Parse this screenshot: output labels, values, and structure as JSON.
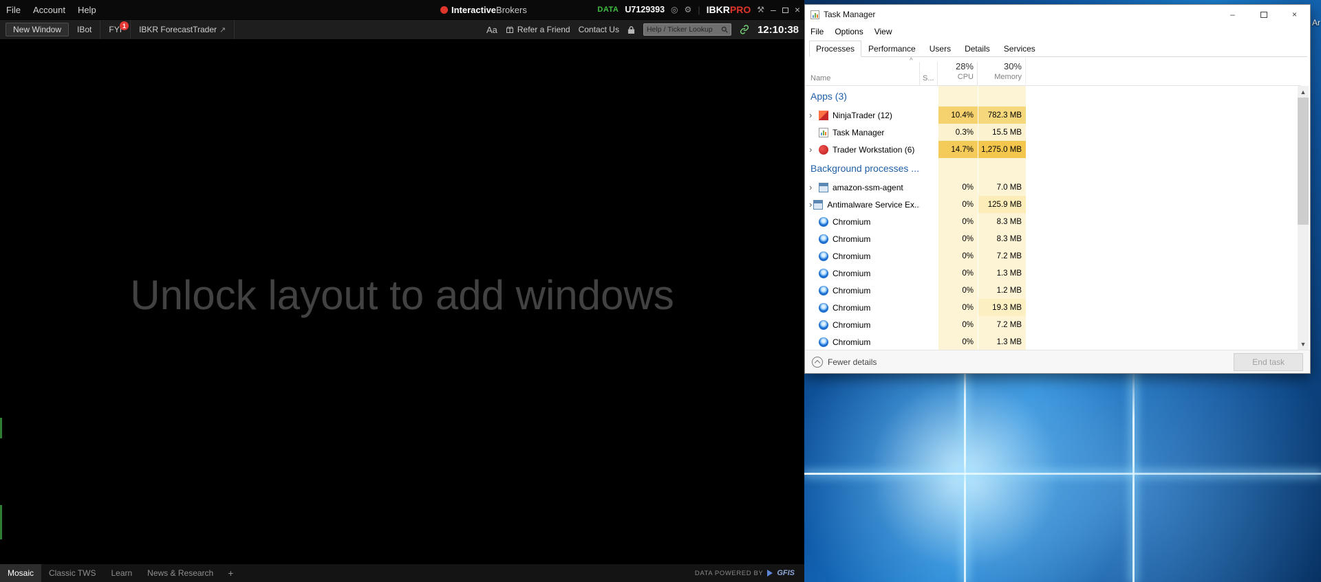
{
  "tws": {
    "menubar": {
      "items": [
        "File",
        "Account",
        "Help"
      ]
    },
    "logo": {
      "part1": "Interactive",
      "part2": "Brokers"
    },
    "status": {
      "data_label": "DATA",
      "account": "U7129393"
    },
    "brand": {
      "ibkr": "IBKR",
      "pro": "PRO"
    },
    "toolbar": {
      "new_window": "New Window",
      "ibot": "IBot",
      "fyi": "FYI",
      "fyi_badge": "1",
      "forecast": "IBKR ForecastTrader",
      "forecast_arrow": "↗",
      "font_toggle": "Aa",
      "refer": "Refer a Friend",
      "contact": "Contact Us",
      "search_placeholder": "Help / Ticker Lookup",
      "time": "12:10:38"
    },
    "main_message": "Unlock layout to add windows",
    "bottombar": {
      "tabs": [
        "Mosaic",
        "Classic TWS",
        "Learn",
        "News & Research"
      ],
      "add_tab": "+",
      "powered_by": "DATA POWERED BY",
      "provider": "GFIS"
    }
  },
  "task_manager": {
    "title": "Task Manager",
    "menu": [
      "File",
      "Options",
      "View"
    ],
    "tabs": [
      "Processes",
      "Performance",
      "Users",
      "Details",
      "Services"
    ],
    "active_tab": "Processes",
    "columns": {
      "name": "Name",
      "status": "S...",
      "cpu_total": "28%",
      "cpu_label": "CPU",
      "mem_total": "30%",
      "mem_label": "Memory"
    },
    "heading_cell_color": "#fdf4d6",
    "groups": [
      {
        "label": "Apps (3)",
        "rows": [
          {
            "name": "NinjaTrader (12)",
            "icon": "ninjatrader-icon",
            "expandable": true,
            "cpu": "10.4%",
            "memory": "782.3 MB",
            "cpu_color": "#f6d26e",
            "mem_color": "#f6d87c"
          },
          {
            "name": "Task Manager",
            "icon": "taskmanager-icon",
            "expandable": false,
            "cpu": "0.3%",
            "memory": "15.5 MB",
            "cpu_color": "#fdf2cf",
            "mem_color": "#fdf2cf"
          },
          {
            "name": "Trader Workstation (6)",
            "icon": "trader-workstation-icon",
            "expandable": true,
            "cpu": "14.7%",
            "memory": "1,275.0 MB",
            "cpu_color": "#f4ca58",
            "mem_color": "#f3c64e"
          }
        ]
      },
      {
        "label": "Background processes ...",
        "rows": [
          {
            "name": "amazon-ssm-agent",
            "icon": "app-window-icon",
            "expandable": true,
            "cpu": "0%",
            "memory": "7.0 MB",
            "cpu_color": "#fdf4d6",
            "mem_color": "#fdf4d6"
          },
          {
            "name": "Antimalware Service Ex...",
            "icon": "app-window-icon",
            "expandable": true,
            "cpu": "0%",
            "memory": "125.9 MB",
            "cpu_color": "#fdf4d6",
            "mem_color": "#fbecb8"
          },
          {
            "name": "Chromium",
            "icon": "chromium-icon",
            "expandable": false,
            "cpu": "0%",
            "memory": "8.3 MB",
            "cpu_color": "#fdf4d6",
            "mem_color": "#fdf4d6"
          },
          {
            "name": "Chromium",
            "icon": "chromium-icon",
            "expandable": false,
            "cpu": "0%",
            "memory": "8.3 MB",
            "cpu_color": "#fdf4d6",
            "mem_color": "#fdf4d6"
          },
          {
            "name": "Chromium",
            "icon": "chromium-icon",
            "expandable": false,
            "cpu": "0%",
            "memory": "7.2 MB",
            "cpu_color": "#fdf4d6",
            "mem_color": "#fdf4d6"
          },
          {
            "name": "Chromium",
            "icon": "chromium-icon",
            "expandable": false,
            "cpu": "0%",
            "memory": "1.3 MB",
            "cpu_color": "#fdf4d6",
            "mem_color": "#fdf4d6"
          },
          {
            "name": "Chromium",
            "icon": "chromium-icon",
            "expandable": false,
            "cpu": "0%",
            "memory": "1.2 MB",
            "cpu_color": "#fdf4d6",
            "mem_color": "#fdf4d6"
          },
          {
            "name": "Chromium",
            "icon": "chromium-icon",
            "expandable": false,
            "cpu": "0%",
            "memory": "19.3 MB",
            "cpu_color": "#fdf4d6",
            "mem_color": "#fcf0c2"
          },
          {
            "name": "Chromium",
            "icon": "chromium-icon",
            "expandable": false,
            "cpu": "0%",
            "memory": "7.2 MB",
            "cpu_color": "#fdf4d6",
            "mem_color": "#fdf4d6"
          },
          {
            "name": "Chromium",
            "icon": "chromium-icon",
            "expandable": false,
            "cpu": "0%",
            "memory": "1.3 MB",
            "cpu_color": "#fdf4d6",
            "mem_color": "#fdf4d6"
          }
        ]
      }
    ],
    "footer": {
      "details_toggle": "Fewer details",
      "end_task": "End task"
    }
  },
  "desktop": {
    "icon_label": "Ar"
  }
}
